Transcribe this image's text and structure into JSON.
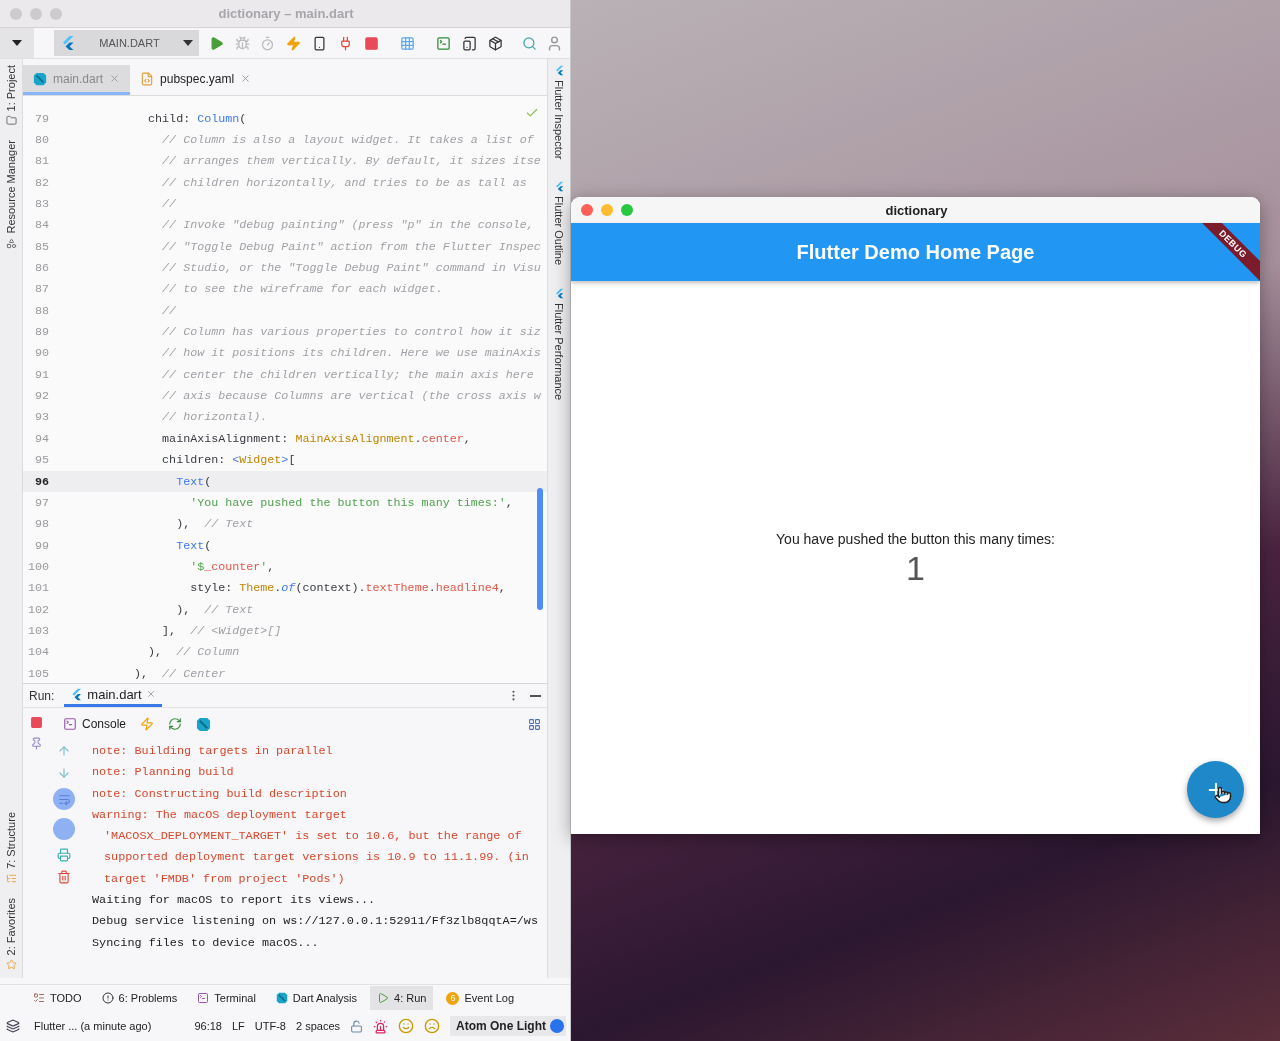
{
  "ide": {
    "title": "dictionary – main.dart",
    "toolbar": {
      "run_config": "MAIN.DART"
    },
    "left_tool_tabs_top": [
      {
        "label": "1: Project",
        "kind": "project"
      },
      {
        "label": "Resource Manager",
        "kind": "resources"
      }
    ],
    "left_tool_tabs_bottom": [
      {
        "label": "7: Structure",
        "kind": "structure"
      },
      {
        "label": "2: Favorites",
        "kind": "favorites"
      }
    ],
    "editor_tabs": [
      {
        "label": "main.dart",
        "kind": "dart",
        "selected": true
      },
      {
        "label": "pubspec.yaml",
        "kind": "yaml",
        "selected": false
      }
    ],
    "right_tool_tabs": [
      {
        "label": "Flutter Inspector"
      },
      {
        "label": "Flutter Outline"
      },
      {
        "label": "Flutter Performance"
      }
    ],
    "code": {
      "lines": [
        {
          "number": "79",
          "current": false,
          "tokens": [
            {
              "kind": "plain",
              "text": "      child: "
            },
            {
              "kind": "call",
              "text": "Column"
            },
            {
              "kind": "plain",
              "text": "("
            }
          ]
        },
        {
          "number": "80",
          "current": false,
          "tokens": [
            {
              "kind": "comment",
              "text": "        // Column is also a layout widget. It takes a list of"
            }
          ]
        },
        {
          "number": "81",
          "current": false,
          "tokens": [
            {
              "kind": "comment",
              "text": "        // arranges them vertically. By default, it sizes itse"
            }
          ]
        },
        {
          "number": "82",
          "current": false,
          "tokens": [
            {
              "kind": "comment",
              "text": "        // children horizontally, and tries to be as tall as"
            }
          ]
        },
        {
          "number": "83",
          "current": false,
          "tokens": [
            {
              "kind": "comment",
              "text": "        //"
            }
          ]
        },
        {
          "number": "84",
          "current": false,
          "tokens": [
            {
              "kind": "comment",
              "text": "        // Invoke \"debug painting\" (press \"p\" in the console,"
            }
          ]
        },
        {
          "number": "85",
          "current": false,
          "tokens": [
            {
              "kind": "comment",
              "text": "        // \"Toggle Debug Paint\" action from the Flutter Inspec"
            }
          ]
        },
        {
          "number": "86",
          "current": false,
          "tokens": [
            {
              "kind": "comment",
              "text": "        // Studio, or the \"Toggle Debug Paint\" command in Visu"
            }
          ]
        },
        {
          "number": "87",
          "current": false,
          "tokens": [
            {
              "kind": "comment",
              "text": "        // to see the wireframe for each widget."
            }
          ]
        },
        {
          "number": "88",
          "current": false,
          "tokens": [
            {
              "kind": "comment",
              "text": "        //"
            }
          ]
        },
        {
          "number": "89",
          "current": false,
          "tokens": [
            {
              "kind": "comment",
              "text": "        // Column has various properties to control how it siz"
            }
          ]
        },
        {
          "number": "90",
          "current": false,
          "tokens": [
            {
              "kind": "comment",
              "text": "        // how it positions its children. Here we use mainAxis"
            }
          ]
        },
        {
          "number": "91",
          "current": false,
          "tokens": [
            {
              "kind": "comment",
              "text": "        // center the children vertically; the main axis here"
            }
          ]
        },
        {
          "number": "92",
          "current": false,
          "tokens": [
            {
              "kind": "comment",
              "text": "        // axis because Columns are vertical (the cross axis w"
            }
          ]
        },
        {
          "number": "93",
          "current": false,
          "tokens": [
            {
              "kind": "comment",
              "text": "        // horizontal)."
            }
          ]
        },
        {
          "number": "94",
          "current": false,
          "tokens": [
            {
              "kind": "plain",
              "text": "        mainAxisAlignment: "
            },
            {
              "kind": "type",
              "text": "MainAxisAlignment"
            },
            {
              "kind": "plain",
              "text": "."
            },
            {
              "kind": "member",
              "text": "center"
            },
            {
              "kind": "plain",
              "text": ","
            }
          ]
        },
        {
          "number": "95",
          "current": false,
          "tokens": [
            {
              "kind": "plain",
              "text": "        children: "
            },
            {
              "kind": "call",
              "text": "<"
            },
            {
              "kind": "type",
              "text": "Widget"
            },
            {
              "kind": "call",
              "text": ">"
            },
            {
              "kind": "plain",
              "text": "["
            }
          ]
        },
        {
          "number": "96",
          "current": true,
          "tokens": [
            {
              "kind": "call",
              "text": "          Text"
            },
            {
              "kind": "plain",
              "text": "("
            }
          ]
        },
        {
          "number": "97",
          "current": false,
          "tokens": [
            {
              "kind": "string",
              "text": "            'You have pushed the button this many times:'"
            },
            {
              "kind": "plain",
              "text": ","
            }
          ]
        },
        {
          "number": "98",
          "current": false,
          "tokens": [
            {
              "kind": "plain",
              "text": "          ),  "
            },
            {
              "kind": "comment",
              "text": "// Text"
            }
          ]
        },
        {
          "number": "99",
          "current": false,
          "tokens": [
            {
              "kind": "call",
              "text": "          Text"
            },
            {
              "kind": "plain",
              "text": "("
            }
          ]
        },
        {
          "number": "100",
          "current": false,
          "tokens": [
            {
              "kind": "string",
              "text": "            '$"
            },
            {
              "kind": "member",
              "text": "_counter"
            },
            {
              "kind": "string",
              "text": "'"
            },
            {
              "kind": "plain",
              "text": ","
            }
          ]
        },
        {
          "number": "101",
          "current": false,
          "tokens": [
            {
              "kind": "plain",
              "text": "            style: "
            },
            {
              "kind": "type",
              "text": "Theme"
            },
            {
              "kind": "plain",
              "text": "."
            },
            {
              "kind": "method",
              "text": "of"
            },
            {
              "kind": "plain",
              "text": "(context)."
            },
            {
              "kind": "member",
              "text": "textTheme"
            },
            {
              "kind": "plain",
              "text": "."
            },
            {
              "kind": "member",
              "text": "headline4"
            },
            {
              "kind": "plain",
              "text": ","
            }
          ]
        },
        {
          "number": "102",
          "current": false,
          "tokens": [
            {
              "kind": "plain",
              "text": "          ),  "
            },
            {
              "kind": "comment",
              "text": "// Text"
            }
          ]
        },
        {
          "number": "103",
          "current": false,
          "tokens": [
            {
              "kind": "plain",
              "text": "        ],  "
            },
            {
              "kind": "comment",
              "text": "// <Widget>[]"
            }
          ]
        },
        {
          "number": "104",
          "current": false,
          "tokens": [
            {
              "kind": "plain",
              "text": "      ),  "
            },
            {
              "kind": "comment",
              "text": "// Column"
            }
          ]
        },
        {
          "number": "105",
          "current": false,
          "tokens": [
            {
              "kind": "plain",
              "text": "    ),  "
            },
            {
              "kind": "comment",
              "text": "// Center"
            }
          ]
        }
      ]
    },
    "run": {
      "label": "Run:",
      "tab": {
        "label": "main.dart",
        "selected": true
      },
      "console_tab": "Console",
      "console": [
        {
          "kind": "error",
          "wrapped": false,
          "text": "note: Building targets in parallel"
        },
        {
          "kind": "error",
          "wrapped": false,
          "text": "note: Planning build"
        },
        {
          "kind": "error",
          "wrapped": false,
          "text": "note: Constructing build description"
        },
        {
          "kind": "error",
          "wrapped": false,
          "text": "warning: The macOS deployment target"
        },
        {
          "kind": "error",
          "wrapped": true,
          "text": "'MACOSX_DEPLOYMENT_TARGET' is set to 10.6, but the range of"
        },
        {
          "kind": "error",
          "wrapped": true,
          "text": "supported deployment target versions is 10.9 to 11.1.99. (in"
        },
        {
          "kind": "error",
          "wrapped": true,
          "text": "target 'FMDB' from project 'Pods')"
        },
        {
          "kind": "info",
          "wrapped": false,
          "text": "Waiting for macOS to report its views..."
        },
        {
          "kind": "info",
          "wrapped": false,
          "text": "Debug service listening on ws://127.0.0.1:52911/Ff3zlb8qqtA=/ws"
        },
        {
          "kind": "info",
          "wrapped": false,
          "text": "Syncing files to device macOS..."
        }
      ]
    },
    "tool_windows": [
      {
        "label": "TODO",
        "kind": "todo",
        "selected": false
      },
      {
        "label": "6: Problems",
        "kind": "problems",
        "selected": false
      },
      {
        "label": "Terminal",
        "kind": "terminal",
        "selected": false
      },
      {
        "label": "Dart Analysis",
        "kind": "dart",
        "selected": false
      },
      {
        "label": "4: Run",
        "kind": "run",
        "selected": true
      },
      {
        "label": "Event Log",
        "kind": "log",
        "badge": "6",
        "selected": false
      }
    ],
    "status_bar": {
      "vcs": "Flutter ... (a minute ago)",
      "position": "96:18",
      "line_separator": "LF",
      "encoding": "UTF-8",
      "indent": "2 spaces",
      "theme": "Atom One Light"
    }
  },
  "app": {
    "title": "dictionary",
    "app_bar_title": "Flutter Demo Home Page",
    "banner": "DEBUG",
    "message": "You have pushed the button this many times:",
    "counter": "1"
  }
}
